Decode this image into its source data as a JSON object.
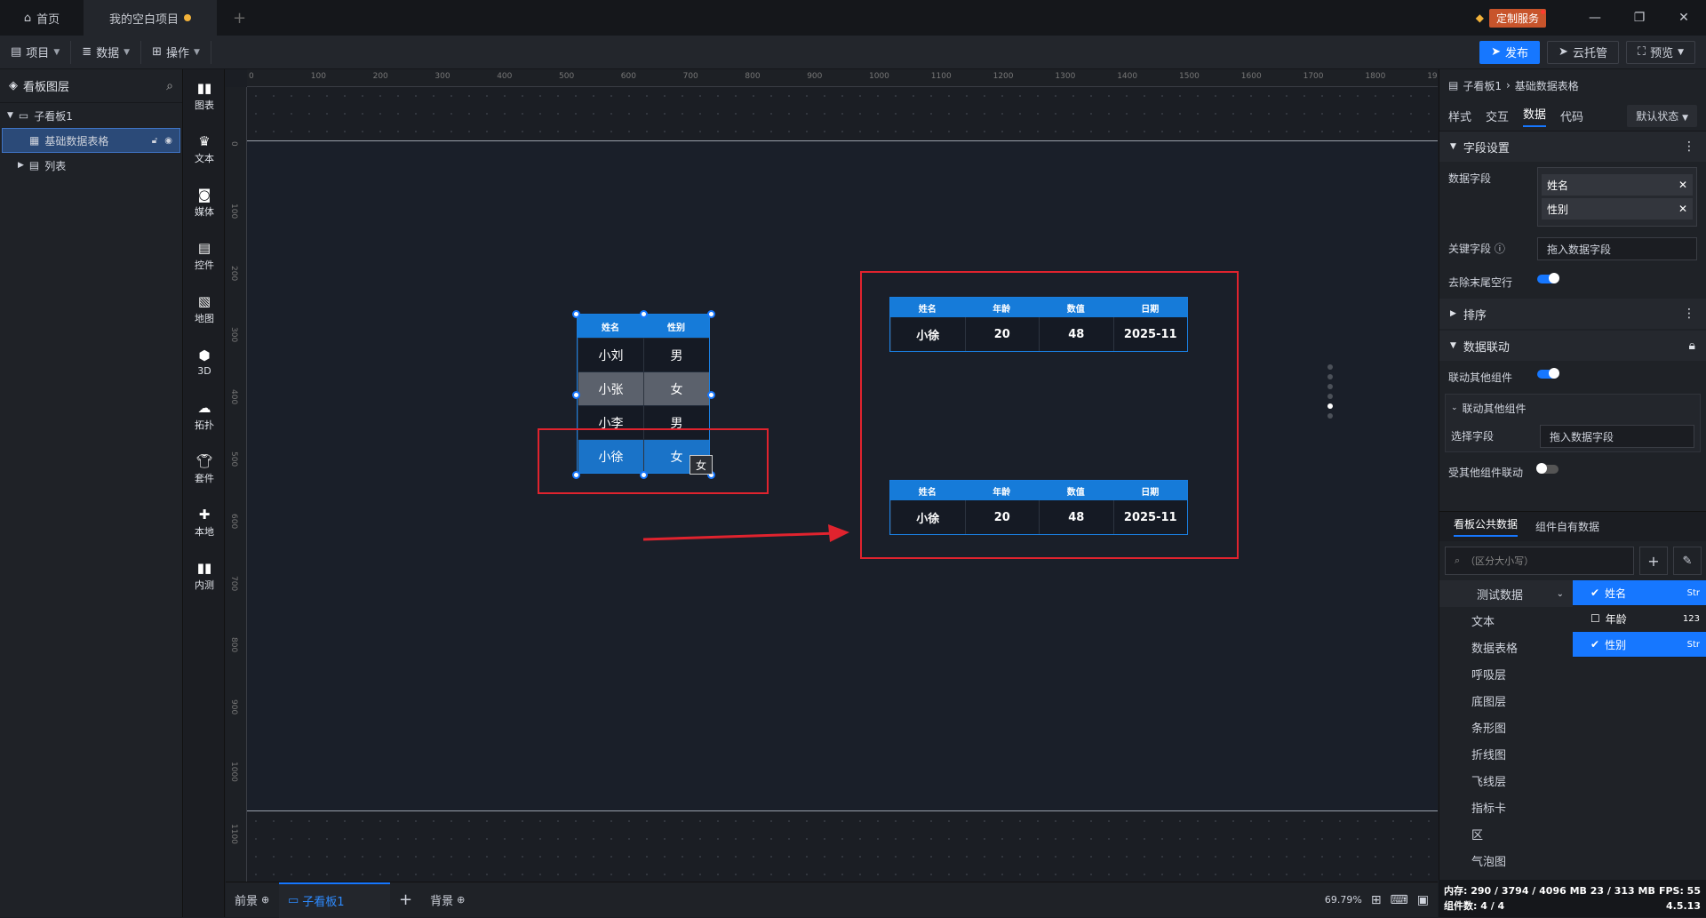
{
  "titlebar": {
    "home_tab": "首页",
    "project_tab": "我的空白项目",
    "custom_service": "定制服务"
  },
  "menubar": {
    "items": [
      "项目",
      "数据",
      "操作"
    ],
    "publish": "发布",
    "cloud_host": "云托管",
    "preview": "预览"
  },
  "layers": {
    "title": "看板图层",
    "items": [
      "子看板1",
      "基础数据表格",
      "列表"
    ]
  },
  "tools": [
    "图表",
    "文本",
    "媒体",
    "控件",
    "地图",
    "3D",
    "拓扑",
    "套件",
    "本地",
    "内测"
  ],
  "rulers": {
    "h": [
      "0",
      "100",
      "200",
      "300",
      "400",
      "500",
      "600",
      "700",
      "800",
      "900",
      "1000",
      "1100",
      "1200",
      "1300",
      "1400",
      "1500",
      "1600",
      "1700",
      "1800",
      "1900"
    ],
    "v": [
      "0",
      "100",
      "200",
      "300",
      "400",
      "500",
      "600",
      "700",
      "800",
      "900",
      "1000",
      "1100"
    ]
  },
  "table_small": {
    "headers": [
      "姓名",
      "性别"
    ],
    "rows": [
      [
        "小刘",
        "男"
      ],
      [
        "小张",
        "女"
      ],
      [
        "小李",
        "男"
      ],
      [
        "小徐",
        "女"
      ]
    ],
    "tooltip": "女"
  },
  "table_linked": {
    "headers": [
      "姓名",
      "年龄",
      "数值",
      "日期"
    ],
    "row": [
      "小徐",
      "20",
      "48",
      "2025-11"
    ]
  },
  "bottombar": {
    "foreground": "前景",
    "subboard": "子看板1",
    "background": "背景",
    "zoom": "69.79%"
  },
  "rightpanel": {
    "breadcrumb": [
      "子看板1",
      "基础数据表格"
    ],
    "tabs": [
      "样式",
      "交互",
      "数据",
      "代码"
    ],
    "state": "默认状态",
    "field_settings": "字段设置",
    "data_field_label": "数据字段",
    "data_fields": [
      "姓名",
      "性别"
    ],
    "key_field_label": "关键字段",
    "drop_placeholder": "拖入数据字段",
    "remove_trailing": "去除末尾空行",
    "sort": "排序",
    "data_link": "数据联动",
    "link_other": "联动其他组件",
    "link_other_sub": "联动其他组件",
    "select_field": "选择字段",
    "linked_by_other": "受其他组件联动",
    "ds_tabs": [
      "看板公共数据",
      "组件自有数据"
    ],
    "search_placeholder": "（区分大小写）",
    "categories": [
      "测试数据",
      "文本",
      "数据表格",
      "呼吸层",
      "底图层",
      "条形图",
      "折线图",
      "飞线层",
      "指标卡",
      "区",
      "气泡图"
    ],
    "fields": [
      {
        "name": "姓名",
        "type": "Str",
        "checked": true
      },
      {
        "name": "年龄",
        "type": "123",
        "checked": false
      },
      {
        "name": "性别",
        "type": "Str",
        "checked": true
      }
    ]
  },
  "status": {
    "memory": "内存: 290 / 3794 / 4096 MB  23 / 313 MB",
    "fps": "FPS: 55",
    "components": "组件数: 4 / 4",
    "version": "4.5.13"
  },
  "colors": {
    "accent": "#1677ff",
    "highlight": "#e0232e",
    "table_header": "#167bd9"
  }
}
